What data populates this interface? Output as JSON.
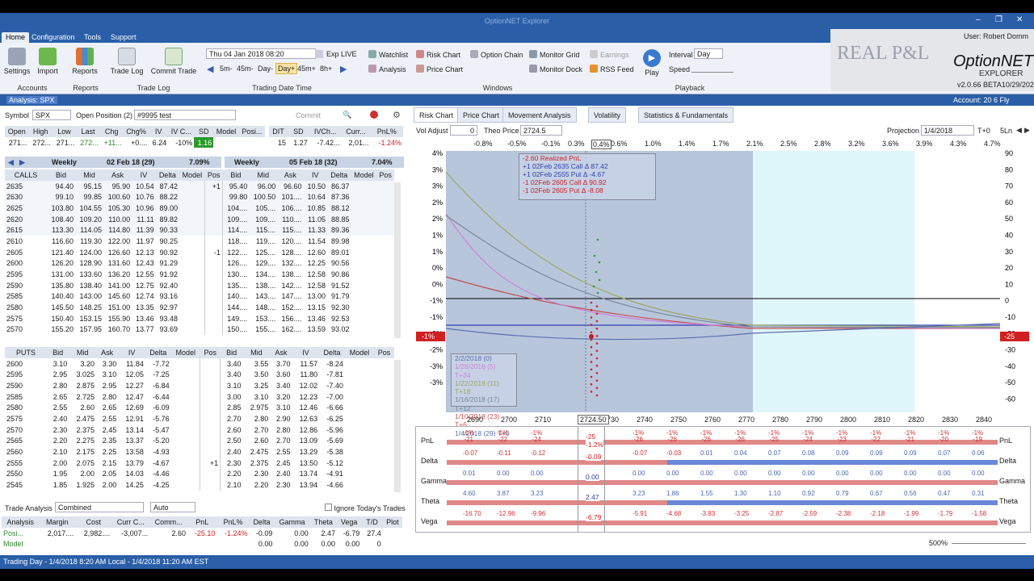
{
  "window": {
    "title": "OptionNET Explorer"
  },
  "menu_tabs": [
    "Home",
    "Configuration",
    "Tools",
    "Support"
  ],
  "ribbon": {
    "accounts": {
      "settings": "Settings",
      "import": "Import",
      "group": "Accounts"
    },
    "reports": {
      "reports": "Reports",
      "group": "Reports"
    },
    "tradelog": {
      "trade_log": "Trade Log",
      "commit_trade": "Commit Trade",
      "group": "Trade Log"
    },
    "trading_date": {
      "date_value": "Thu 04 Jan 2018 08:20",
      "exp": "Exp LIVE",
      "steps": [
        "5m-",
        "45m-",
        "Day-",
        "Day+",
        "45m+",
        "8h+"
      ],
      "group": "Trading Date",
      "group2": "Time"
    },
    "windows": {
      "items": [
        "Watchlist",
        "Risk Chart",
        "Option Chain",
        "Monitor Grid",
        "Earnings",
        "Analysis",
        "Price Chart",
        "Monitor Dock",
        "RSS Feed"
      ],
      "group": "Windows"
    },
    "playback": {
      "play": "Play",
      "interval_label": "Interval",
      "interval_value": "Day",
      "speed_label": "Speed",
      "group": "Playback"
    },
    "user": "User: Robert Domm",
    "version": "v2.0.66 BETA10/29/2021",
    "watermark": "REAL P&L",
    "brand": "OptionNET",
    "brand_sub": "EXPLORER"
  },
  "status": {
    "analysis": "Analysis: SPX",
    "account": "Account: 20 6 Fly"
  },
  "left": {
    "symbol_label": "Symbol",
    "symbol": "SPX",
    "open_position_label": "Open Position (2)",
    "open_position": "#9995 test",
    "commit": "Commit",
    "quote_headers": [
      "Open",
      "High",
      "Low",
      "Last",
      "Chg",
      "Chg%",
      "IV",
      "IV C...",
      "SD",
      "Model",
      "Posi..."
    ],
    "quote_values": [
      "271...",
      "272...",
      "271...",
      "272...",
      "+11...",
      "+0....",
      "6.24",
      "-10%",
      "1.16",
      "",
      ""
    ],
    "dit_headers": [
      "DIT",
      "SD",
      "IVCh...",
      "Curr...",
      "PnL%"
    ],
    "dit_values": [
      "15",
      "1.27",
      "-7.42...",
      "2,01...",
      "-1.24%"
    ],
    "calls_left_title": "Weekly",
    "calls_left_exp": "02 Feb 18 (29)",
    "calls_left_iv": "7.09%",
    "calls_right_title": "Weekly",
    "calls_right_exp": "05 Feb 18 (32)",
    "calls_right_iv": "7.04%",
    "calls_headers": [
      "CALLS",
      "Bid",
      "Mid",
      "Ask",
      "IV",
      "Delta",
      "Model",
      "Pos"
    ],
    "calls_right_headers": [
      "Bid",
      "Mid",
      "Ask",
      "IV",
      "Delta",
      "Model",
      "Pos"
    ],
    "calls": [
      [
        "2635",
        "94.40",
        "95.15",
        "95.90",
        "10.54",
        "87.42",
        "",
        "+1",
        "95.40",
        "96.00",
        "96.60",
        "10.50",
        "86.37"
      ],
      [
        "2630",
        "99.10",
        "99.85",
        "100.60",
        "10.76",
        "88.22",
        "",
        "",
        "99.80",
        "100.50",
        "101....",
        "10.64",
        "87.36"
      ],
      [
        "2625",
        "103.80",
        "104.55",
        "105.30",
        "10.96",
        "89.00",
        "",
        "",
        "104....",
        "105....",
        "106....",
        "10.85",
        "88.12"
      ],
      [
        "2620",
        "108.40",
        "109.20",
        "110.00",
        "11.11",
        "89.82",
        "",
        "",
        "109....",
        "109....",
        "110....",
        "11.05",
        "88.85"
      ],
      [
        "2615",
        "113.30",
        "114.05",
        "114.80",
        "11.39",
        "90.33",
        "",
        "",
        "114....",
        "115....",
        "115....",
        "11.33",
        "89.36"
      ],
      [
        "2610",
        "116.60",
        "119.30",
        "122.00",
        "11.97",
        "90.25",
        "",
        "",
        "118....",
        "119....",
        "120....",
        "11.54",
        "89.98"
      ],
      [
        "2605",
        "121.40",
        "124.00",
        "126.60",
        "12.13",
        "90.92",
        "",
        "-1",
        "122....",
        "125....",
        "128....",
        "12.60",
        "89.01"
      ],
      [
        "2600",
        "126.20",
        "128.90",
        "131.60",
        "12.43",
        "91.29",
        "",
        "",
        "126....",
        "129....",
        "132....",
        "12.25",
        "90.56"
      ],
      [
        "2595",
        "131.00",
        "133.60",
        "136.20",
        "12.55",
        "91.92",
        "",
        "",
        "130....",
        "134....",
        "138....",
        "12.58",
        "90.86"
      ],
      [
        "2590",
        "135.80",
        "138.40",
        "141.00",
        "12.75",
        "92.40",
        "",
        "",
        "135....",
        "138....",
        "142....",
        "12.58",
        "91.52"
      ],
      [
        "2585",
        "140.40",
        "143.00",
        "145.60",
        "12.74",
        "93.16",
        "",
        "",
        "140....",
        "143....",
        "147....",
        "13.00",
        "91.79"
      ],
      [
        "2580",
        "145.50",
        "148.25",
        "151.00",
        "13.35",
        "92.97",
        "",
        "",
        "144....",
        "148....",
        "152....",
        "13.15",
        "92.30"
      ],
      [
        "2575",
        "150.40",
        "153.15",
        "155.90",
        "13.46",
        "93.48",
        "",
        "",
        "149....",
        "153....",
        "156....",
        "13.46",
        "92.53"
      ],
      [
        "2570",
        "155.20",
        "157.95",
        "160.70",
        "13.77",
        "93.69",
        "",
        "",
        "150....",
        "155....",
        "162....",
        "13.59",
        "93.02"
      ]
    ],
    "puts_headers": [
      "PUTS",
      "Bid",
      "Mid",
      "Ask",
      "IV",
      "Delta",
      "Model",
      "Pos"
    ],
    "puts": [
      [
        "2600",
        "3.10",
        "3.20",
        "3.30",
        "11.84",
        "-7.72",
        "",
        "",
        "3.40",
        "3.55",
        "3.70",
        "11.57",
        "-8.24"
      ],
      [
        "2595",
        "2.95",
        "3.025",
        "3.10",
        "12.05",
        "-7.25",
        "",
        "",
        "3.40",
        "3.50",
        "3.60",
        "11.80",
        "-7.81"
      ],
      [
        "2590",
        "2.80",
        "2.875",
        "2.95",
        "12.27",
        "-6.84",
        "",
        "",
        "3.10",
        "3.25",
        "3.40",
        "12.02",
        "-7.40"
      ],
      [
        "2585",
        "2.65",
        "2.725",
        "2.80",
        "12.47",
        "-6.44",
        "",
        "",
        "3.00",
        "3.10",
        "3.20",
        "12.23",
        "-7.00"
      ],
      [
        "2580",
        "2.55",
        "2.60",
        "2.65",
        "12.69",
        "-6.09",
        "",
        "",
        "2.85",
        "2.975",
        "3.10",
        "12.46",
        "-6.66"
      ],
      [
        "2575",
        "2.40",
        "2.475",
        "2.55",
        "12.91",
        "-5.76",
        "",
        "",
        "2.70",
        "2.80",
        "2.90",
        "12.63",
        "-6.25"
      ],
      [
        "2570",
        "2.30",
        "2.375",
        "2.45",
        "13.14",
        "-5.47",
        "",
        "",
        "2.60",
        "2.70",
        "2.80",
        "12.86",
        "-5.96"
      ],
      [
        "2565",
        "2.20",
        "2.275",
        "2.35",
        "13.37",
        "-5.20",
        "",
        "",
        "2.50",
        "2.60",
        "2.70",
        "13.09",
        "-5.69"
      ],
      [
        "2560",
        "2.10",
        "2.175",
        "2.25",
        "13.58",
        "-4.93",
        "",
        "",
        "2.40",
        "2.475",
        "2.55",
        "13.29",
        "-5.38"
      ],
      [
        "2555",
        "2.00",
        "2.075",
        "2.15",
        "13.79",
        "-4.67",
        "",
        "+1",
        "2.30",
        "2.375",
        "2.45",
        "13.50",
        "-5.12"
      ],
      [
        "2550",
        "1.95",
        "2.00",
        "2.05",
        "14.03",
        "-4.46",
        "",
        "",
        "2.20",
        "2.30",
        "2.40",
        "13.74",
        "-4.91"
      ],
      [
        "2545",
        "1.85",
        "1.925",
        "2.00",
        "14.25",
        "-4.25",
        "",
        "",
        "2.10",
        "2.20",
        "2.30",
        "13.94",
        "-4.66"
      ]
    ],
    "trade_analysis_label": "Trade Analysis",
    "trade_analysis_mode": "Combined",
    "trade_analysis_auto": "Auto",
    "ignore_trades": "Ignore Today's Trades",
    "analysis_headers": [
      "Analysis",
      "Margin",
      "Cost",
      "Curr C...",
      "Comm...",
      "PnL",
      "PnL%",
      "Delta",
      "Gamma",
      "Theta",
      "Vega",
      "T/D",
      "Plot"
    ],
    "analysis_rows": [
      [
        "Posi...",
        "2,017....",
        "2,982....",
        "-3,007...",
        "2.60",
        "-25.10",
        "-1.24%",
        "-0.09",
        "0.00",
        "2.47",
        "-6.79",
        "27.4",
        ""
      ],
      [
        "Model",
        "",
        "",
        "",
        "",
        "",
        "",
        "0.00",
        "0.00",
        "0.00",
        "0.00",
        "0",
        ""
      ]
    ]
  },
  "right": {
    "tabs": [
      "Risk Chart",
      "Price Chart",
      "Movement Analysis",
      "Volatility",
      "Statistics & Fundamentals"
    ],
    "vol_adjust_label": "Vol Adjust",
    "vol_adjust": "0",
    "theo_label": "Theo Price",
    "theo": "2724.5",
    "projection_label": "Projection",
    "projection": "1/4/2018",
    "tplus": "T+0",
    "lines": "5Ln",
    "pct_ticks": [
      "-0.8%",
      "-0.5%",
      "-0.1%",
      "0.3%",
      "0.4%",
      "0.6%",
      "1.0%",
      "1.4%",
      "1.7%",
      "2.1%",
      "2.5%",
      "2.8%",
      "3.2%",
      "3.6%",
      "3.9%",
      "4.3%",
      "4.7%"
    ],
    "left_axis": [
      "4%",
      "3%",
      "3%",
      "2%",
      "2%",
      "1%",
      "1%",
      "0%",
      "0%",
      "-1%",
      "-1%",
      "-2%",
      "-2%",
      "-3%",
      "-3%"
    ],
    "right_axis": [
      "90",
      "80",
      "70",
      "60",
      "50",
      "40",
      "30",
      "20",
      "10",
      "0",
      "-10",
      "-20",
      "-30",
      "-40",
      "-50",
      "-60"
    ],
    "left_marker": "-1%",
    "right_marker": "-25",
    "x_ticks": [
      "2690",
      "2700",
      "2710",
      "2720",
      "2730",
      "2740",
      "2750",
      "2760",
      "2770",
      "2780",
      "2790",
      "2800",
      "2810",
      "2820",
      "2830",
      "2840"
    ],
    "x_current": "2724.50",
    "legend_top": [
      "-2.60 Realized PnL",
      "+1 02Feb 2635 Call Δ  87.42",
      "+1 02Feb 2555 Put Δ  -4.67",
      "-1 02Feb 2605 Call Δ  90.92",
      "-1 02Feb 2605 Put Δ  -8.08"
    ],
    "legend_bottom": [
      "2/2/2018 (0)",
      "1/28/2018 (5) T+24",
      "1/22/2018 (11) T+18",
      "1/16/2018 (17) T+12",
      "1/10/2018 (23) T+6",
      "1/4/2018 (29) T+0"
    ],
    "legend_bottom_colors": [
      "#5a6fb0",
      "#d080d8",
      "#9aa860",
      "#788898",
      "#d05050",
      "#5a6fb0"
    ],
    "greeks": [
      {
        "label": "PnL",
        "values": [
          "-1%\n-21",
          "-1%\n-22",
          "-1%\n-24",
          "",
          "",
          "-1%\n-26",
          "-1%\n-26",
          "-1%\n-26",
          "-1%\n-26",
          "-1%\n-25",
          "-1%\n-24",
          "-1%\n-23",
          "-1%\n-22",
          "-1%\n-21",
          "-1%\n-20",
          "-1%\n-19"
        ],
        "current": "-25\n-1.2%"
      },
      {
        "label": "Delta",
        "values": [
          "-0.07",
          "-0.11",
          "-0.12",
          "",
          "",
          "-0.07",
          "-0.03",
          "0.01",
          "0.04",
          "0.07",
          "0.08",
          "0.09",
          "0.09",
          "0.09",
          "0.07",
          "0.06"
        ],
        "current": "-0.09"
      },
      {
        "label": "Gamma",
        "values": [
          "0.01",
          "0.00",
          "0.00",
          "",
          "",
          "0.00",
          "0.00",
          "0.00",
          "0.00",
          "0.00",
          "0.00",
          "0.00",
          "0.00",
          "0.00",
          "0.00",
          "0.00"
        ],
        "current": "0.00"
      },
      {
        "label": "Theta",
        "values": [
          "4.60",
          "3.87",
          "3.23",
          "",
          "",
          "3.23",
          "1.86",
          "1.55",
          "1.30",
          "1.10",
          "0.92",
          "0.79",
          "0.67",
          "0.56",
          "0.47",
          "0.31"
        ],
        "current": "2.47"
      },
      {
        "label": "Vega",
        "values": [
          "-16.70",
          "-12.96",
          "-9.96",
          "",
          "",
          "-5.91",
          "-4.68",
          "-3.83",
          "-3.25",
          "-2.87",
          "-2.59",
          "-2.38",
          "-2.18",
          "-1.99",
          "-1.79",
          "-1.58"
        ],
        "current": "-6.79"
      }
    ],
    "zoom": "500%",
    "chart_data": {
      "type": "line",
      "x": [
        2690,
        2700,
        2710,
        2720,
        2730,
        2740,
        2750,
        2760,
        2770,
        2780,
        2790,
        2800,
        2810,
        2820,
        2830,
        2840
      ],
      "series": [
        {
          "name": "1/4/2018 (29) T+0",
          "values": [
            -21,
            -22,
            -24,
            -25,
            -25,
            -26,
            -26,
            -26,
            -26,
            -25,
            -24,
            -23,
            -22,
            -21,
            -20,
            -19
          ]
        }
      ],
      "ylim": [
        -60,
        90
      ]
    }
  },
  "footer": {
    "text": "Trading Day - 1/4/2018 8:20 AM Local - 1/4/2018 11:20 AM EST"
  }
}
